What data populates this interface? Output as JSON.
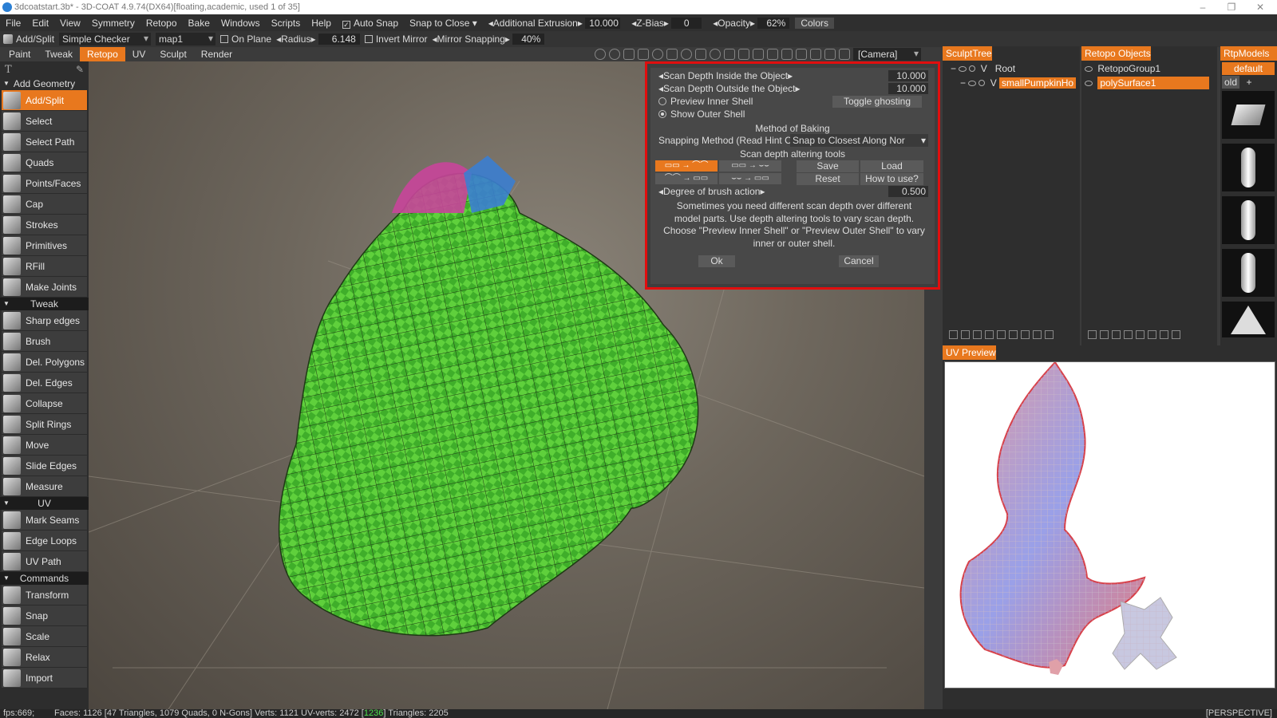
{
  "window": {
    "title": "3dcoatstart.3b* - 3D-COAT 4.9.74(DX64)[floating,academic, used 1 of 35]",
    "controls": [
      "–",
      "❐",
      "✕"
    ]
  },
  "menu": [
    "File",
    "Edit",
    "View",
    "Symmetry",
    "Retopo",
    "Bake",
    "Windows",
    "Scripts",
    "Help"
  ],
  "menu_toolbar": {
    "auto_snap": "Auto Snap",
    "snap_to_close": "Snap to Close",
    "additional_extrusion_label": "Additional Extrusion",
    "additional_extrusion_value": "10.000",
    "zbias_label": "Z-Bias",
    "zbias_value": "0",
    "opacity_label": "Opacity",
    "opacity_value": "62%",
    "colors_btn": "Colors"
  },
  "toolbar2": {
    "mode_label": "Add/Split",
    "material": "Simple Checker",
    "map": "map1",
    "on_plane": "On Plane",
    "radius_label": "Radius",
    "radius_value": "6.148",
    "invert_mirror": "Invert Mirror",
    "mirror_snapping_label": "Mirror Snapping",
    "mirror_snapping_value": "40%"
  },
  "room_tabs": [
    "Paint",
    "Tweak",
    "Retopo",
    "UV",
    "Sculpt",
    "Render"
  ],
  "active_tab": "Retopo",
  "camera": "[Camera]",
  "left_panel": {
    "sections": [
      {
        "title": "Add Geometry",
        "tools": [
          "Add/Split",
          "Select",
          "Select Path",
          "Quads",
          "Points/Faces",
          "Cap",
          "Strokes",
          "Primitives",
          "RFill",
          "Make Joints"
        ]
      },
      {
        "title": "Tweak",
        "tools": [
          "Sharp edges",
          "Brush",
          "Del. Polygons",
          "Del. Edges",
          "Collapse",
          "Split Rings",
          "Move",
          "Slide Edges",
          "Measure"
        ]
      },
      {
        "title": "UV",
        "tools": [
          "Mark Seams",
          "Edge Loops",
          "UV Path"
        ]
      },
      {
        "title": "Commands",
        "tools": [
          "Transform",
          "Snap",
          "Scale",
          "Relax",
          "Import"
        ]
      }
    ]
  },
  "dialog": {
    "scan_inside_label": "Scan Depth Inside the Object",
    "scan_inside_value": "10.000",
    "scan_outside_label": "Scan Depth Outside the Object",
    "scan_outside_value": "10.000",
    "preview_inner": "Preview Inner Shell",
    "show_outer": "Show Outer Shell",
    "toggle_ghosting": "Toggle ghosting",
    "method_title": "Method of Baking",
    "snapping_label": "Snapping Method (Read Hint C",
    "snapping_value": "Snap to Closest Along Nor",
    "scan_tools_title": "Scan depth altering tools",
    "save": "Save",
    "load": "Load",
    "reset": "Reset",
    "how_to_use": "How to use?",
    "degree_label": "Degree of brush action",
    "degree_value": "0.500",
    "description": "Sometimes you need different scan depth over different model parts. Use depth altering tools to vary scan depth. Choose \"Preview Inner Shell\" or \"Preview Outer Shell\" to vary inner or outer shell.",
    "ok": "Ok",
    "cancel": "Cancel"
  },
  "sculpt_tree": {
    "title": "SculptTree",
    "root": "Root",
    "v1": "V",
    "v2": "V",
    "child": "smallPumpkinHo"
  },
  "retopo_objects": {
    "title": "Retopo Objects",
    "group": "RetopoGroup1",
    "surface": "polySurface1"
  },
  "rtp_models": {
    "title": "RtpModels",
    "default": "default",
    "old": "old",
    "add": "+"
  },
  "uv_preview": {
    "title": "UV Preview"
  },
  "status": {
    "fps": "fps:669;",
    "faces": "Faces: 1126 [47 Triangles, 1079 Quads, 0 N-Gons] Verts: 1121  UV-verts: 2472 [",
    "uv_highlight": "1236",
    "triangles": "]  Triangles: 2205",
    "view": "[PERSPECTIVE]"
  }
}
